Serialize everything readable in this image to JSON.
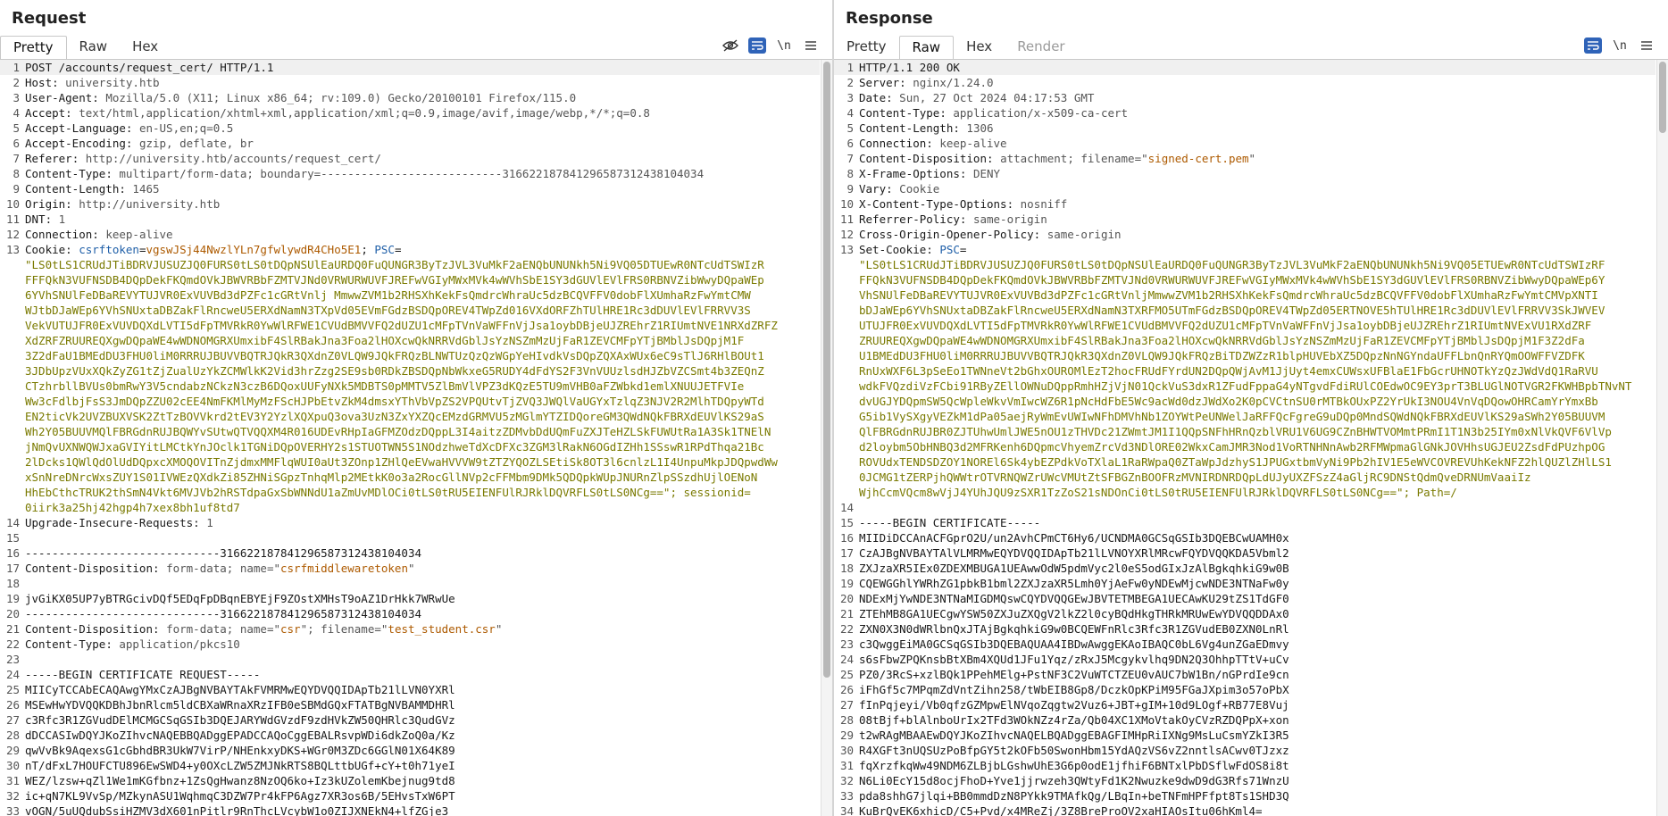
{
  "request": {
    "title": "Request",
    "tabs": [
      "Pretty",
      "Raw",
      "Hex"
    ],
    "active_tab": "Pretty",
    "icons": [
      "hide-icon",
      "wrap-icon",
      "newline-icon",
      "menu-icon"
    ],
    "lines": [
      "POST /accounts/request_cert/ HTTP/1.1",
      "Host: university.htb",
      "User-Agent: Mozilla/5.0 (X11; Linux x86_64; rv:109.0) Gecko/20100101 Firefox/115.0",
      "Accept: text/html,application/xhtml+xml,application/xml;q=0.9,image/avif,image/webp,*/*;q=0.8",
      "Accept-Language: en-US,en;q=0.5",
      "Accept-Encoding: gzip, deflate, br",
      "Referer: http://university.htb/accounts/request_cert/",
      "Content-Type: multipart/form-data; boundary=---------------------------316622187841296587312438104034",
      "Content-Length: 1465",
      "Origin: http://university.htb",
      "DNT: 1",
      "Connection: keep-alive",
      "Cookie: csrftoken=vgswJSj44NwzlYLn7gfwlywdR4CHo5E1; PSC=",
      "\"LS0tLS1CRUdJTiBDRVJUSUZJQ0FURS0tLS0tDQpNSUlEaURDQ0FuQUNGR3ByTzJVL3VuMkF2aENQbUNUNkh5Ni9VQ05DTUEwR0NTcUdTSWIzR",
      "FFFQkN3VUFNSDB4DQpDekFKQmdOVkJBWVRBbFZMTVJNd0VRWURWUVFJREFwVGIyMWxMVk4wWVhSbE1SY3dGUVlEVlFRS0RBNVZibWwyDQpaWEp",
      "6YVhSNUlFeDBaREVYTUJVR0ExVUVBd3dPZFc1cGRtVnlj MmwwZVM1b2RHSXhKekFsQmdrcWhraUc5dzBCQVFFV0dobFlXUmhaRzFwYmtCMW",
      "WJtbDJaWEp6YVhSNUxtaDBZakFlRncweU5ERXdNamN3TXpVd05EVmFGdzBSDQpOREV4TWpZd016VXdORFZhTUlHRE1Rc3dDUVlEVlFRRVV3S",
      "VekVUTUJFR0ExVUVDQXdLVTI5dFpTMVRkR0YwWlRFWE1CVUdBMVVFQ2dUZU1cMFpTVnVaWFFnVjJsa1oybDBjeUJZREhrZ1RIUmtNVE1NRXdZRFZ",
      "XdZRFZRUUREQXgwDQpaWE4wWDNOMGRXUmxibF4SlRBakJna3Foa2lHOXcwQkNRRVdGblJsYzNSZmMzUjFaR1ZEVCMFpYTjBMblJsDQpjM1F",
      "3Z2dFaU1BMEdDU3FHU0liM0RRRUJBUVVBQTRJQkR3QXdnZ0VLQW9JQkFRQzBLNWTUzQzQzWGpYeHIvdkVsDQpZQXAxWUx6eC9sTlJ6RHlBOUt1",
      "3JDbUpzVUxXQkZyZG1tZjZualUzYkZCMWlkK2Vid3hrZzg2SE9sb0RDkZBSDQpNbWkxeG5RUDY4dFdYS2F3VnVUUzlsdHJZbVZCSmt4b3ZEQnZ",
      "CTzhrbllBVUs0bmRwY3V5cndabzNCkzN3czB6DQoxUUFyNXk5MDBTS0pMMTV5ZlBmVlVPZ3dKQzE5TU9mVHB0aFZWbkd1emlXNUUJETFVIe",
      "Ww3cFdlbjFsS3JmDQpZZU02cEE4NmFKMlMyMzFScHJPbEtvZkM4dmsxYThVbVpZS2VPQUtvTjZVQ3JWQlVaUGYxTzlqZ3NJV2R2MlhTDQpyWTd",
      "EN2ticVk2UVZBUXVSK2ZtTzBOVVkrd2tEV3Y2YzlXQXpuQ3ova3UzN3ZxYXZQcEMzdGRMVU5zMGlmYTZIDQoreGM3QWdNQkFBRXdEUVlKS29aS",
      "Wh2Y05BUUVMQlFBRGdnRUJBQWYvSUtwQTVQQXM4R016UDEvRHpIaGFMZOdzDQppL3I4aitzZDMvbDdUQmFuZXJTeHZLSkFUWUtRa1A3Sk1TNElN",
      "jNmQvUXNWQWJxaGVIYitLMCtkYnJOclk1TGNiDQpOVERHY2s1STUOTWN5S1NOdzhweTdXcDFXc3ZGM3lRakN6OGdIZHh1SSswR1RPdThqa21Bc",
      "2lDcks1QWlQdOlUdDQpxcXMOQOVITnZjdmxMMFlqWUI0aUt3ZOnp1ZHlQeEVwaHVVVW9tZTZYQOZLSEtiSk8OT3l6cnlzL1I4UnpuMkpJDQpwdWw",
      "xSnNreDNrcWxsZUY1S01IVWEzQXdkZi85ZHNiSGpzTnhqMlp2MEtkK0o3a2RocGllNVp2cFFMbm9DMk5QDQpkWUpJNURnZlpSSzdhUjlOENoN",
      "HhEbCthcTRUK2thSmN4Vkt6MVJVb2hRSTdpaGxSbWNNdU1aZmUvMDlOCi0tLS0tRU5EIENFUlRJRklDQVRFLS0tLS0NCg==\"; sessionid=",
      "0iirk3a25hj42hgp4h7xex8bh1uf8td7",
      "Upgrade-Insecure-Requests: 1",
      "",
      "-----------------------------316622187841296587312438104034",
      "Content-Disposition: form-data; name=\"csrfmiddlewaretoken\"",
      "",
      "jvGiKX05UP7yBTRGcivDQf5EDqFpDBqnEBYEjF9ZOstXMHsT9oAZ1DrHkk7WRwUe",
      "-----------------------------316622187841296587312438104034",
      "Content-Disposition: form-data; name=\"csr\"; filename=\"test_student.csr\"",
      "Content-Type: application/pkcs10",
      "",
      "-----BEGIN CERTIFICATE REQUEST-----",
      "MIICyTCCAbECAQAwgYMxCzAJBgNVBAYTAkFVMRMwEQYDVQQIDApTb21lLVN0YXRl",
      "MSEwHwYDVQQKDBhJbnRlcm5ldCBXaWRnaXRzIFB0eSBMdGQxFTATBgNVBAMMDHRl",
      "c3Rfc3R1ZGVudDElMCMGCSqGSIb3DQEJARYWdGVzdF9zdHVkZW50QHRlc3QudGVz",
      "dDCCASIwDQYJKoZIhvcNAQEBBQADggEPADCCAQoCggEBALRsvpWDi6dkZoQ0a/Kz",
      "qwVvBk9AqexsG1cGbhdBR3UkW7VirP/NHEnkxyDKS+WGr0M3ZDc6GGlN01X64K89",
      "nT/dFxL7HOUFCTU896EwSWD4+y0OXcLZW5ZMJNkRTS8BQLttbUGf+cY+t0h71yeI",
      "WEZ/lzsw+qZl1We1mKGfbnz+1ZsQgHwanz8NzOQ6ko+Iz3kUZolemKbejnug9td8",
      "ic+qN7KL9VvSp/MZkynASU1WqhmqC3DZW7Pr4kFP6Agz7XR3os6B/5EHvsTxW6PT",
      "vOGN/5uUQdubSsiHZMV3dX601nPitlr9RnThcLVcybW1o0ZIJXNEkN4+lfZGje3"
    ]
  },
  "response": {
    "title": "Response",
    "tabs": [
      "Pretty",
      "Raw",
      "Hex",
      "Render"
    ],
    "active_tab": "Raw",
    "icons": [
      "wrap-icon",
      "newline-icon",
      "menu-icon"
    ],
    "lines": [
      "HTTP/1.1 200 OK",
      "Server: nginx/1.24.0",
      "Date: Sun, 27 Oct 2024 04:17:53 GMT",
      "Content-Type: application/x-x509-ca-cert",
      "Content-Length: 1306",
      "Connection: keep-alive",
      "Content-Disposition: attachment; filename=\"signed-cert.pem\"",
      "X-Frame-Options: DENY",
      "Vary: Cookie",
      "X-Content-Type-Options: nosniff",
      "Referrer-Policy: same-origin",
      "Cross-Origin-Opener-Policy: same-origin",
      "Set-Cookie: PSC=",
      "\"LS0tLS1CRUdJTiBDRVJUSUZJQ0FURS0tLS0tDQpNSUlEaURDQ0FuQUNGR3ByTzJVL3VuMkF2aENQbUNUNkh5Ni9VQ05ETUEwR0NTcUdTSWIzRF",
      "FFQkN3VUFNSDB4DQpDekFKQmdOVkJBWVRBbFZMTVJNd0VRWURWUVFJREFwVGIyMWxMVk4wWVhSbE1SY3dGUVlEVlFRS0RBNVZibWwyDQpaWEp6Y",
      "VhSNUlFeDBaREVYTUJVR0ExVUVBd3dPZFc1cGRtVnljMmwwZVM1b2RHSXhKekFsQmdrcWhraUc5dzBCQVFFV0dobFlXUmhaRzFwYmtCMVpXNTI",
      "bDJaWEp6YVhSNUxtaDBZakFlRncweU5ERXdNamN3TXRFMO5UTmFGdzBSDQpOREV4TWpZd05ERTNOVE5hTUlHRE1Rc3dDUVlEVlFRRVV3SkJWVEV",
      "UTUJFR0ExVUVDQXdLVTI5dFpTMVRkR0YwWlRFWE1CVUdBMVVFQ2dUZU1cMFpTVnVaWFFnVjJsa1oybDBjeUJZREhrZ1RIUmtNVExVU1RXdZRF",
      "ZRUUREQXgwDQpaWE4wWDNOMGRXUmxibF4SlRBakJna3Foa2lHOXcwQkNRRVdGblJsYzNSZmMzUjFaR1ZEVCMFpYTjBMblJsDQpjM1F3Z2dFa",
      "U1BMEdDU3FHU0liM0RRRUJBUVVBQTRJQkR3QXdnZ0VLQW9JQkFRQzBiTDZWZzR1blpHUVEbXZ5DQpzNnNGYndaUFFLbnQnRYQmOOWFFVZDFK",
      "RnUxWXF6L3pSeEo1TWNneVt2bGhxOUROMlEzT2hocFRUdFYrdUN2DQpQWjAvM1JjUyt4emxCUWsxUFBlaE1FbGcrUHNOTkYzQzJWdVdQ1RaRVU",
      "wdkFVQzdiVzFCbi91RByZEllOWNuDQppRmhHZjVjN01QckVuS3dxR1ZFudFppaG4yNTgvdFdiRUlCOEdwOC9EY3prT3BLUGlNOTVGR2FKWHBpbTNvNT",
      "dvUGJYDQpmSW5QcWpleWkvVmIwcWZ6R1pNcHdFbE5Wc9acWd0dzJWdXo2K0pCVCtnSU0rMTBkOUxPZ2YrUkI3NOU4VnVqDQowOHRCamYrYmxBb",
      "G5ib1VySXgyVEZkM1dPa05aejRyWmEvUWIwNFhDMVhNb1ZOYWtPeUNWelJaRFFQcFgreG9uDQp0MndSQWdNQkFBRXdEUVlKS29aSWh2Y05BUUVM",
      "QlFBRGdnRUJBR0ZJTUhwUmlJWE5nOU1zTHVDc21ZWmtJM1I1QQpSNFhHRnQzblVRU1V6UG9CZnBHWTVOMmtPRmI1T1N3b25IYm0xNlVkQVF6VlVp",
      "d2loybm5ObHNBQ3d2MFRKenh6DQpmcVhyemZrcVd3NDlORE02WkxCamJMR3Nod1VoRTNHNnAwb2RFMWpmaGlGNkJOVHhsUGJEU2ZsdFdPUzhpOG",
      "ROVUdxTENDSDZOY1NOREl6Sk4ybEZPdkVoTXlaL1RaRWpaQ0ZTaWpJdzhyS1JPUGxtbmVyNi9Pb2hIV1E5eWVCOVREVUhKekNFZ2hlQUZlZHlLS1",
      "0JCMG1tZERPjhQWWtrOTVRNQWZrUWcVMUtZtSFBGZnBOOFRzMVNIRDNRDQpLdUJyUXZFSzZ4aGljRC9DNStQdmQveDRNUmVaaiIz",
      "WjhCcmVQcm8wVjJ4YUhJQU9zSXR1TzZoS21sNDOnCi0tLS0tRU5EIENFUlRJRklDQVRFLS0tLS0NCg==\"; Path=/",
      "",
      "-----BEGIN CERTIFICATE-----",
      "MIIDiDCCAnACFGprO2U/un2AvhCPmCT6Hy6/UCNDMA0GCSqGSIb3DQEBCwUAMH0x",
      "CzAJBgNVBAYTAlVLMRMwEQYDVQQIDApTb21lLVNOYXRlMRcwFQYDVQQKDA5Vbml2",
      "ZXJzaXR5IEx0ZDEXMBUGA1UEAwwOdW5pdmVyc2l0eS5odGIxJzAlBgkqhkiG9w0B",
      "CQEWGGhlYWRhZG1pbkB1bml2ZXJzaXR5Lmh0YjAeFw0yNDEwMjcwNDE3NTNaFw0y",
      "NDExMjYwNDE3NTNaMIGDMQswCQYDVQQGEwJBVTETMBEGA1UECAwKU29tZS1TdGF0",
      "ZTEhMB8GA1UECgwYSW50ZXJuZXQgV2lkZ2l0cyBQdHkgTHRkMRUwEwYDVQQDDAx0",
      "ZXN0X3N0dWRlbnQxJTAjBgkqhkiG9w0BCQEWFnRlc3Rfc3R1ZGVudEB0ZXN0LnRl",
      "c3QwggEiMA0GCSqGSIb3DQEBAQUAA4IBDwAwggEKAoIBAQC0bL6Vg4unZGaEDmvy",
      "s6sFbwZPQKnsbBtXBm4XQUd1JFu1Yqz/zRxJ5Mcgykvlhq9DN2Q3OhhpTTtV+uCv",
      "PZ0/3RcS+xzlBQk1PPehMElg+PstNF3C2VuWTCTZEU0vAUC7bW1Bn/nGPrdIe9cn",
      "iFhGf5c7MPqmZdVntZihn258/tWbEIB8Gp8/DczkOpKPiM95FGaJXpim3o57oPbX",
      "fInPqjeyi/Vb0qfzGZMpwElNVqoZqgtw2Vuz6+JBT+gIM+10d9LOgf+RB77E8Vuj",
      "08tBjf+blAlnboUrIx2TFd3WOkNZz4rZa/Qb04XC1XMoVtakOyCVzRZDQPpX+xon",
      "t2wRAgMBAAEwDQYJKoZIhvcNAQELBQADggEBAGFIMHpRiIXNg9MsLuCsmYZkI3R5",
      "R4XGFt3nUQSUzPoBfpGY5t2kOFb50SwonHbm15YdAQzVS6vZ2nntlsACwv0TJzxz",
      "fqXrzfkqWw49NDM6ZLBjbLGshwUhE3G6p0odE1jfhiF6BNTxlPbDSflwFdOS8i8t",
      "N6Li0EcY15d8ocjFhoD+Yve1jjrwzeh3QWtyFd1K2Nwuzke9dwD9dG3Rfs71WnzU",
      "pda8shhG7jlqi+BB0mmdDzN8PYkk9TMAfkQg/LBqIn+beTNFmHPFfpt8Ts1SHD3Q",
      "KuBrQvEK6xhicD/C5+Pvd/x4MReZj/3Z8BreProOV2xaHIAOsItu06hKml4="
    ]
  }
}
